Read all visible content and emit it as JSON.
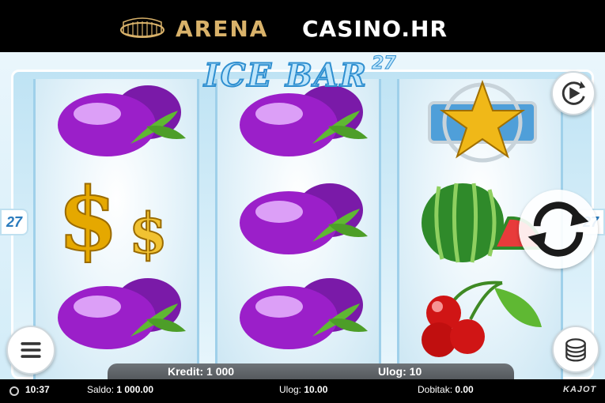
{
  "header": {
    "brand_arena": "ARENA",
    "brand_casino": "CASINO.HR",
    "logo_icon": "colosseum-icon"
  },
  "game": {
    "title": "ICE BAR",
    "title_number": "27",
    "lines_left": "27",
    "lines_right": "27",
    "reels": [
      [
        "plum",
        "dollar",
        "plum"
      ],
      [
        "plum",
        "plum",
        "plum"
      ],
      [
        "star",
        "watermelon",
        "cherries"
      ]
    ],
    "buttons": {
      "autoplay_icon": "autoplay-icon",
      "spin_icon": "spin-arrows-icon",
      "menu_icon": "hamburger-menu-icon",
      "bet_icon": "chip-stack-icon"
    },
    "colors": {
      "plum": "#9b1fc9",
      "leaf": "#5fb833",
      "gold": "#e5a800",
      "header_gold": "#d9b26a",
      "ice_blue": "#2f8fd0"
    }
  },
  "credit_bar": {
    "kredit_label": "Kredit:",
    "kredit_value": "1 000",
    "ulog_label": "Ulog:",
    "ulog_value": "10"
  },
  "status": {
    "time": "10:37",
    "saldo_label": "Saldo:",
    "saldo_value": "1 000.00",
    "ulog_label": "Ulog:",
    "ulog_value": "10.00",
    "dobitak_label": "Dobitak:",
    "dobitak_value": "0.00",
    "provider": "KAJOT"
  }
}
